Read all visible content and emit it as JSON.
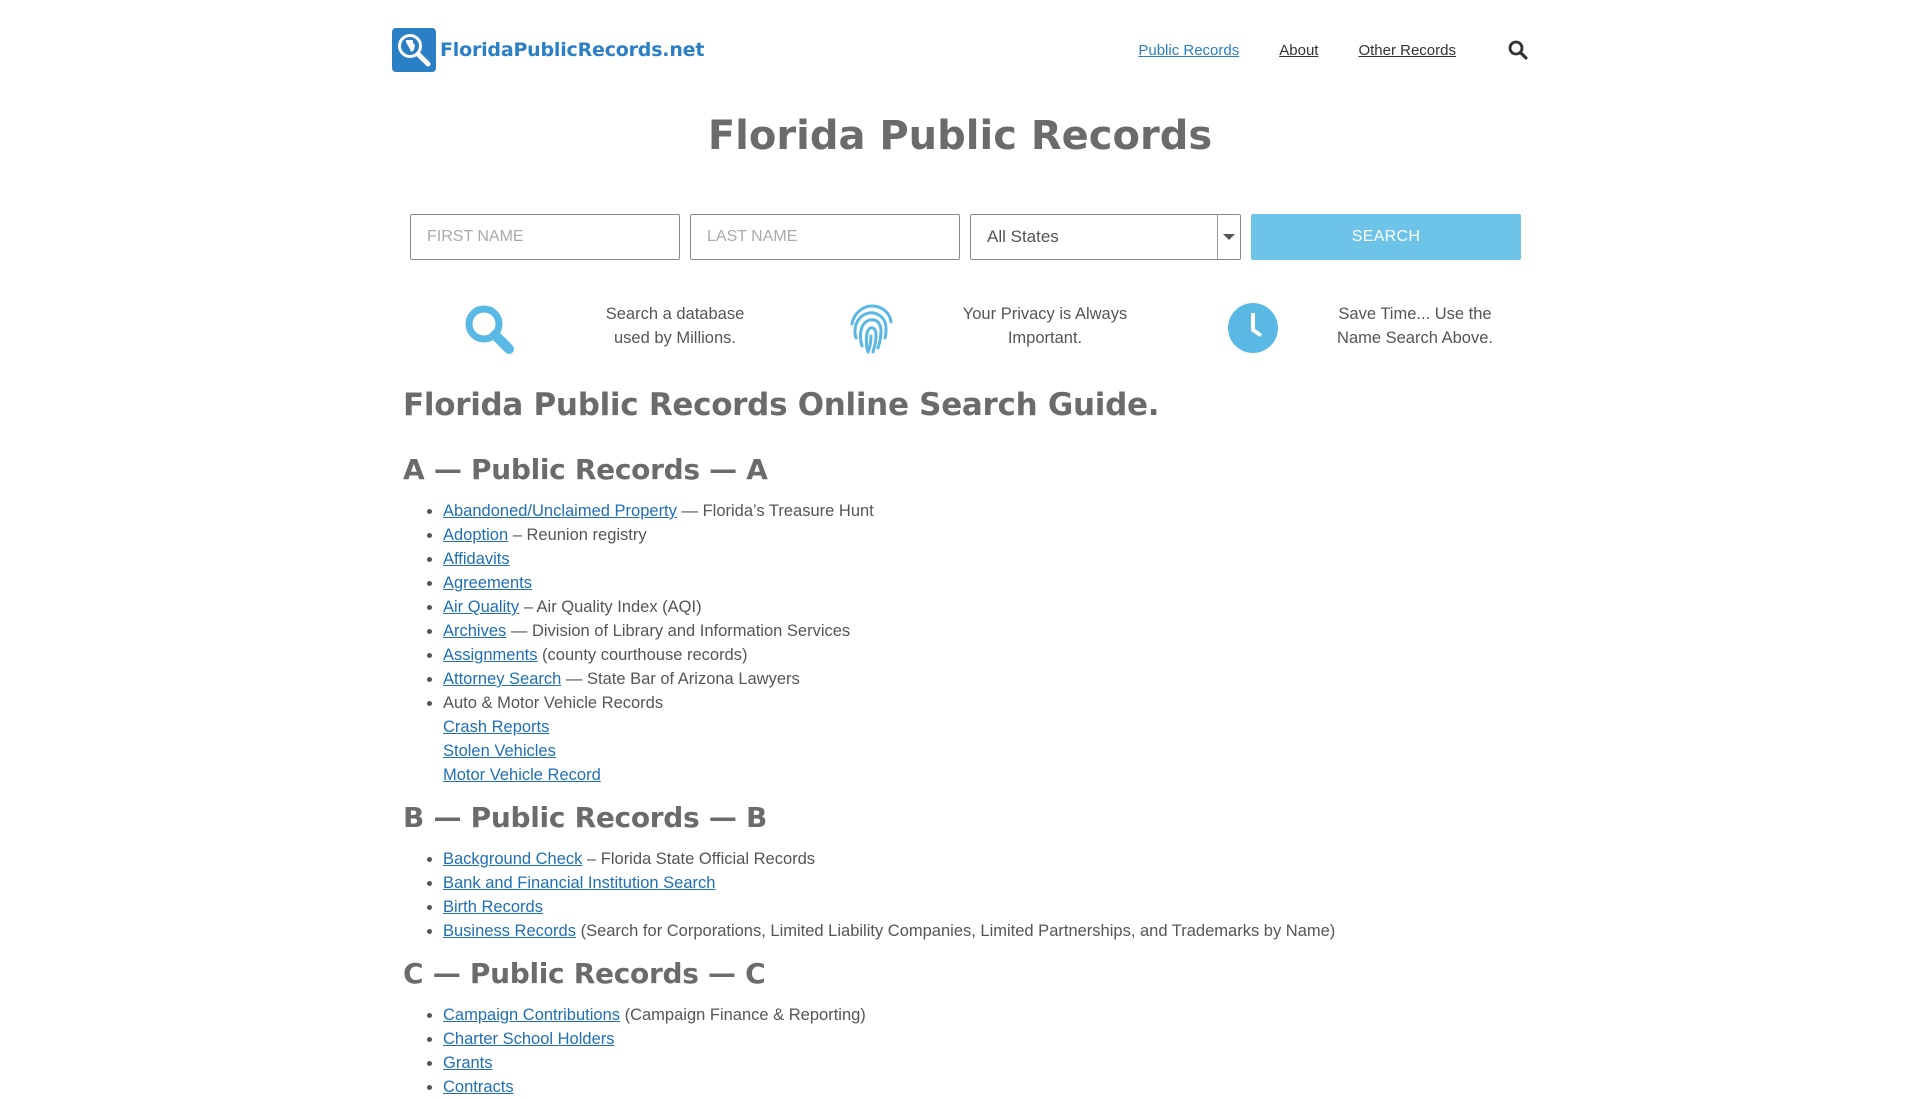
{
  "header": {
    "logo_text": "FloridaPublicRecords.net",
    "nav": [
      {
        "label": "Public Records",
        "active": true
      },
      {
        "label": "About",
        "active": false
      },
      {
        "label": "Other Records",
        "active": false
      }
    ],
    "search_icon": "search-icon"
  },
  "page_title": "Florida Public Records",
  "search_form": {
    "first_name_placeholder": "FIRST NAME",
    "last_name_placeholder": "LAST NAME",
    "state_selected": "All States",
    "submit_label": "SEARCH"
  },
  "features": [
    {
      "icon": "search-icon",
      "text_line1": "Search a database",
      "text_line2": "used by Millions."
    },
    {
      "icon": "fingerprint-icon",
      "text_line1": "Your Privacy is Always",
      "text_line2": "Important."
    },
    {
      "icon": "clock-icon",
      "text_line1": "Save Time... Use the",
      "text_line2": "Name Search Above."
    }
  ],
  "guide_title": "Florida Public Records Online Search Guide.",
  "sections": [
    {
      "heading": "A — Public Records — A",
      "items": [
        {
          "link": "Abandoned/Unclaimed Property",
          "suffix": " — Florida’s Treasure Hunt"
        },
        {
          "link": "Adoption",
          "suffix": " – Reunion registry"
        },
        {
          "link": "Affidavits",
          "suffix": ""
        },
        {
          "link": "Agreements",
          "suffix": ""
        },
        {
          "link": "Air Quality",
          "suffix": " – Air Quality Index (AQI)"
        },
        {
          "link": "Archives",
          "suffix": " — Division of Library and Information Services"
        },
        {
          "link": "Assignments",
          "suffix": " (county courthouse records)"
        },
        {
          "link": "Attorney Search",
          "suffix": " — State Bar of Arizona Lawyers"
        },
        {
          "text": "Auto & Motor Vehicle Records",
          "sub": [
            "Crash Reports",
            "Stolen Vehicles",
            "Motor Vehicle Record"
          ]
        }
      ]
    },
    {
      "heading": "B — Public Records — B",
      "items": [
        {
          "link": "Background Check",
          "suffix": " – Florida State Official Records"
        },
        {
          "link": "Bank and Financial Institution Search",
          "suffix": ""
        },
        {
          "link": "Birth Records",
          "suffix": ""
        },
        {
          "link": "Business Records",
          "suffix": " (Search for Corporations, Limited Liability Companies, Limited Partnerships, and Trademarks by Name)"
        }
      ]
    },
    {
      "heading": "C — Public Records — C",
      "items": [
        {
          "link": "Campaign Contributions",
          "suffix": " (Campaign Finance & Reporting)"
        },
        {
          "link": "Charter School Holders",
          "suffix": ""
        },
        {
          "link": "Grants",
          "suffix": ""
        },
        {
          "link": "Contracts",
          "suffix": ""
        }
      ]
    }
  ],
  "colors": {
    "brand_blue": "#2b7fc5",
    "link_blue": "#1f6fb5",
    "accent_light_blue": "#6ec4e8",
    "heading_gray": "#6b6b6b",
    "text_gray": "#555555"
  }
}
